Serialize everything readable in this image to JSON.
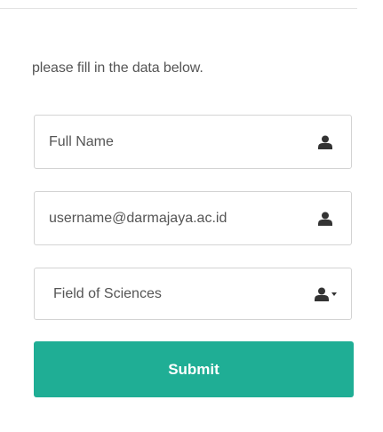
{
  "form": {
    "instructions": "please fill in the data below.",
    "full_name": {
      "placeholder": "Full Name",
      "value": "",
      "icon": "user-icon"
    },
    "email": {
      "placeholder": "username@darmajaya.ac.id",
      "value": "",
      "icon": "user-icon"
    },
    "field_of_sciences": {
      "selected": "Field of Sciences",
      "icon": "user-dropdown-icon"
    },
    "submit_label": "Submit"
  },
  "colors": {
    "accent": "#1fae95",
    "text": "#555555",
    "border": "#d3d3d3"
  }
}
